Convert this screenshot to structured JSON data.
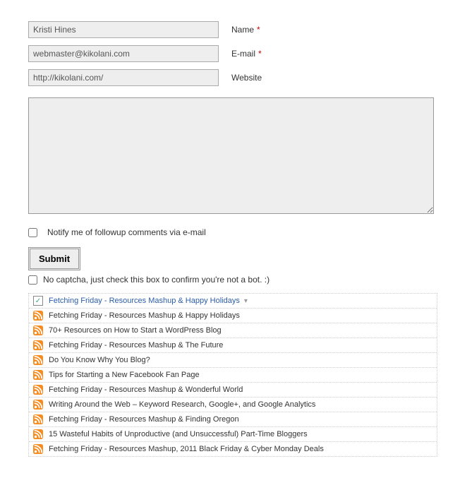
{
  "form": {
    "name": {
      "value": "Kristi Hines",
      "label": "Name",
      "required": "*"
    },
    "email": {
      "value": "webmaster@kikolani.com",
      "label": "E-mail",
      "required": "*"
    },
    "website": {
      "value": "http://kikolani.com/",
      "label": "Website"
    },
    "comment_value": "",
    "notify_label": "Notify me of followup comments via e-mail",
    "submit_label": "Submit",
    "bot_label": "No captcha, just check this box to confirm you're not a bot. :)"
  },
  "posts": {
    "selected": "Fetching Friday - Resources Mashup & Happy Holidays",
    "items": [
      "Fetching Friday - Resources Mashup & Happy Holidays",
      "70+ Resources on How to Start a WordPress Blog",
      "Fetching Friday - Resources Mashup & The Future",
      "Do You Know Why You Blog?",
      "Tips for Starting a New Facebook Fan Page",
      "Fetching Friday - Resources Mashup & Wonderful World",
      "Writing Around the Web – Keyword Research, Google+, and Google Analytics",
      "Fetching Friday - Resources Mashup & Finding Oregon",
      "15 Wasteful Habits of Unproductive (and Unsuccessful) Part-Time Bloggers",
      "Fetching Friday - Resources Mashup, 2011 Black Friday & Cyber Monday Deals"
    ]
  }
}
